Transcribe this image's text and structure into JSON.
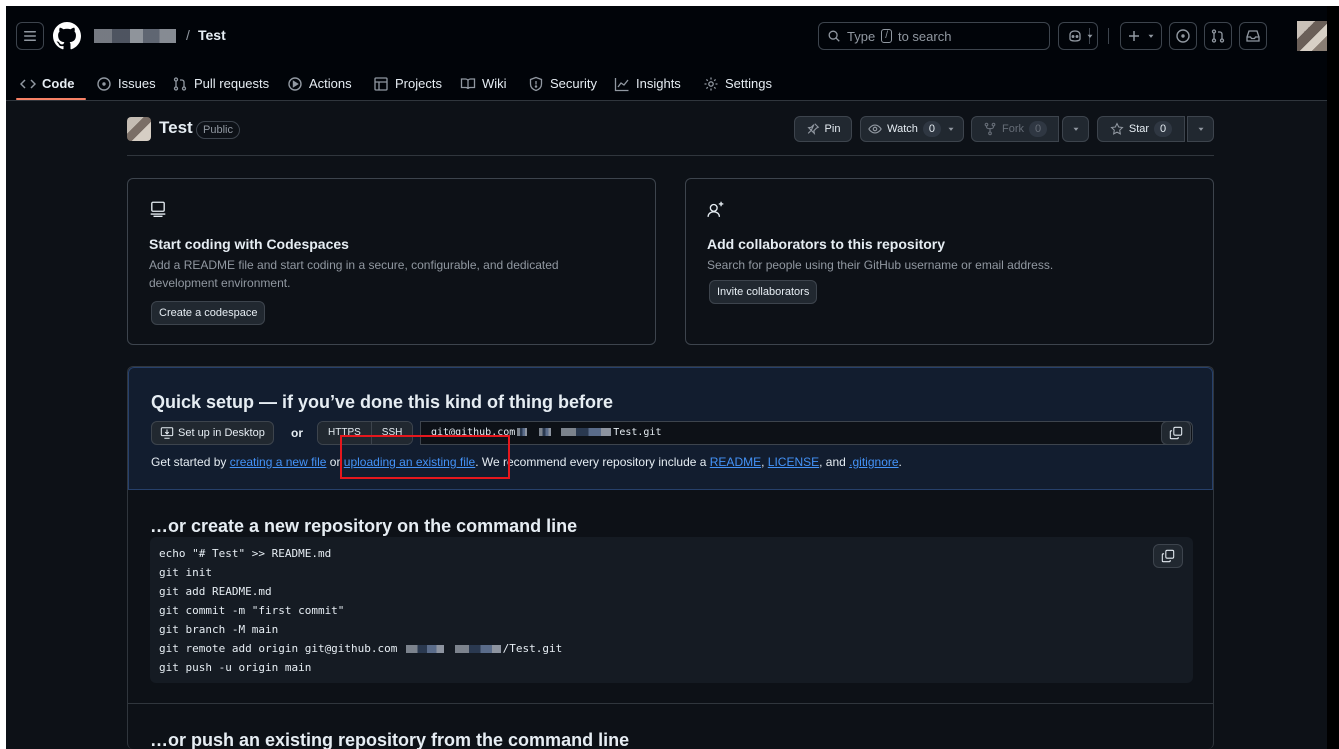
{
  "header": {
    "breadcrumb_sep": "/",
    "repo_name": "Test",
    "search": {
      "prefix": "Type",
      "key": "/",
      "suffix": "to search"
    }
  },
  "nav": {
    "tabs": [
      {
        "label": "Code",
        "icon": "code-icon"
      },
      {
        "label": "Issues",
        "icon": "issue-icon"
      },
      {
        "label": "Pull requests",
        "icon": "pull-request-icon"
      },
      {
        "label": "Actions",
        "icon": "play-icon"
      },
      {
        "label": "Projects",
        "icon": "table-icon"
      },
      {
        "label": "Wiki",
        "icon": "book-icon"
      },
      {
        "label": "Security",
        "icon": "shield-icon"
      },
      {
        "label": "Insights",
        "icon": "graph-icon"
      },
      {
        "label": "Settings",
        "icon": "gear-icon"
      }
    ]
  },
  "repo": {
    "title": "Test",
    "visibility": "Public",
    "pin_label": "Pin",
    "watch_label": "Watch",
    "watch_count": "0",
    "fork_label": "Fork",
    "fork_count": "0",
    "star_label": "Star",
    "star_count": "0"
  },
  "codespaces_card": {
    "title": "Start coding with Codespaces",
    "desc": "Add a README file and start coding in a secure, configurable, and dedicated development environment.",
    "button": "Create a codespace"
  },
  "collab_card": {
    "title": "Add collaborators to this repository",
    "desc": "Search for people using their GitHub username or email address.",
    "button": "Invite collaborators"
  },
  "quick_setup": {
    "title": "Quick setup — if you’ve done this kind of thing before",
    "desktop_button": "Set up in Desktop",
    "or": "or",
    "protocols": [
      "HTTPS",
      "SSH"
    ],
    "url_prefix": "git@github.com",
    "url_suffix": "Test.git",
    "note_start": "Get started by ",
    "link_new_file": "creating a new file",
    "note_or": " or ",
    "link_upload": "uploading an existing file",
    "note_mid": ". We recommend every repository include a ",
    "link_readme": "README",
    "note_comma": ", ",
    "link_license": "LICENSE",
    "note_and": ", and ",
    "link_gitignore": ".gitignore",
    "note_end": "."
  },
  "new_repo_section": {
    "title": "…or create a new repository on the command line",
    "lines": [
      "echo \"# Test\" >> README.md",
      "git init",
      "git add README.md",
      "git commit -m \"first commit\"",
      "git branch -M main",
      "git remote add origin git@github.com",
      "git push -u origin main"
    ],
    "remote_suffix": "/Test.git"
  },
  "push_section": {
    "title": "…or push an existing repository from the command line"
  }
}
